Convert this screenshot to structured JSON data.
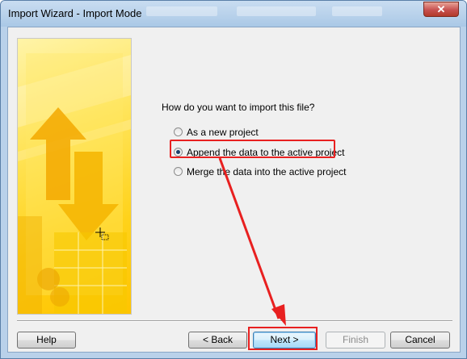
{
  "window": {
    "title": "Import Wizard - Import Mode",
    "close_label": "✕"
  },
  "content": {
    "question": "How do you want to import this file?",
    "options": [
      {
        "label": "As a new project",
        "checked": false
      },
      {
        "label": "Append the data to the active project",
        "checked": true
      },
      {
        "label": "Merge the data into the active project",
        "checked": false
      }
    ]
  },
  "buttons": {
    "help": "Help",
    "back": "< Back",
    "next": "Next >",
    "finish": "Finish",
    "cancel": "Cancel"
  },
  "colors": {
    "annotation": "#e82020"
  }
}
